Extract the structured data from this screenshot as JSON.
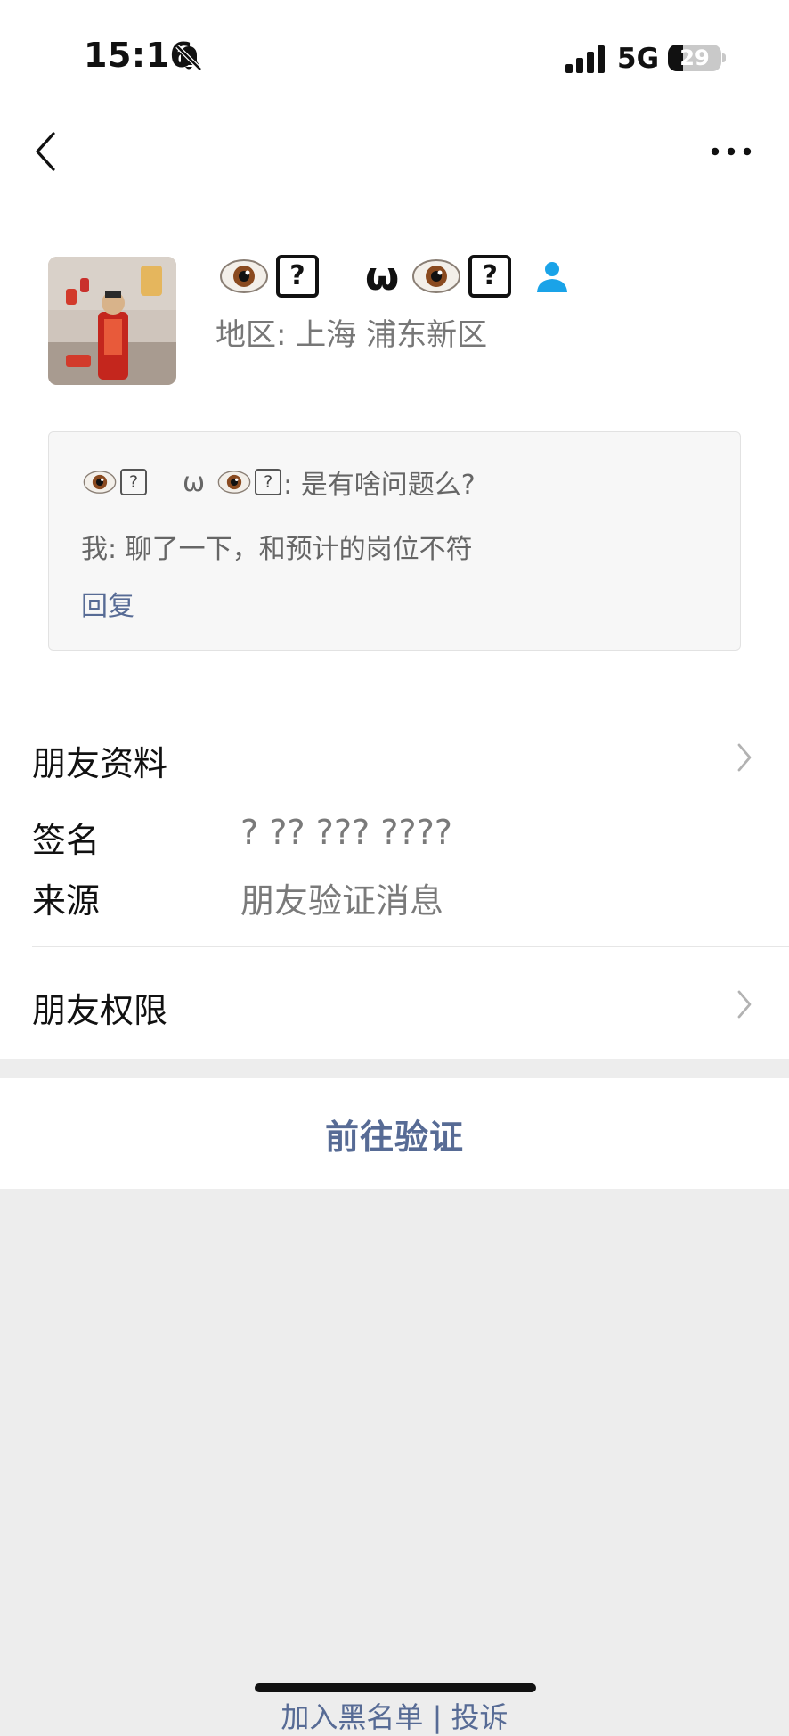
{
  "status_bar": {
    "time": "15:16",
    "network": "5G",
    "battery": "29",
    "battery_level": 0.29
  },
  "nav": {
    "back_icon": "chevron-left-icon",
    "more_icon": "more-dots-icon"
  },
  "profile": {
    "nickname_q": "?",
    "nickname_omega": "ω",
    "region": "地区: 上海 浦东新区",
    "avatar_icon": "avatar-photo",
    "user_icon": "friend-user-icon"
  },
  "message": {
    "sender_q": "?",
    "sender_omega": "ω",
    "sender_text": ": 是有啥问题么?",
    "self_line": "我: 聊了一下，和预计的岗位不符",
    "reply_label": "回复"
  },
  "friend_info": {
    "title": "朋友资料",
    "signature_label": "签名",
    "signature_value": "?  ??  ???  ????",
    "source_label": "来源",
    "source_value": "朋友验证消息"
  },
  "permissions": {
    "title": "朋友权限"
  },
  "actions": {
    "verify_label": "前往验证",
    "bottom_link_partial": "加入黑名单 | 投诉"
  },
  "colors": {
    "link": "#576b95",
    "background": "#ededed",
    "user_icon": "#1aa3e8"
  }
}
